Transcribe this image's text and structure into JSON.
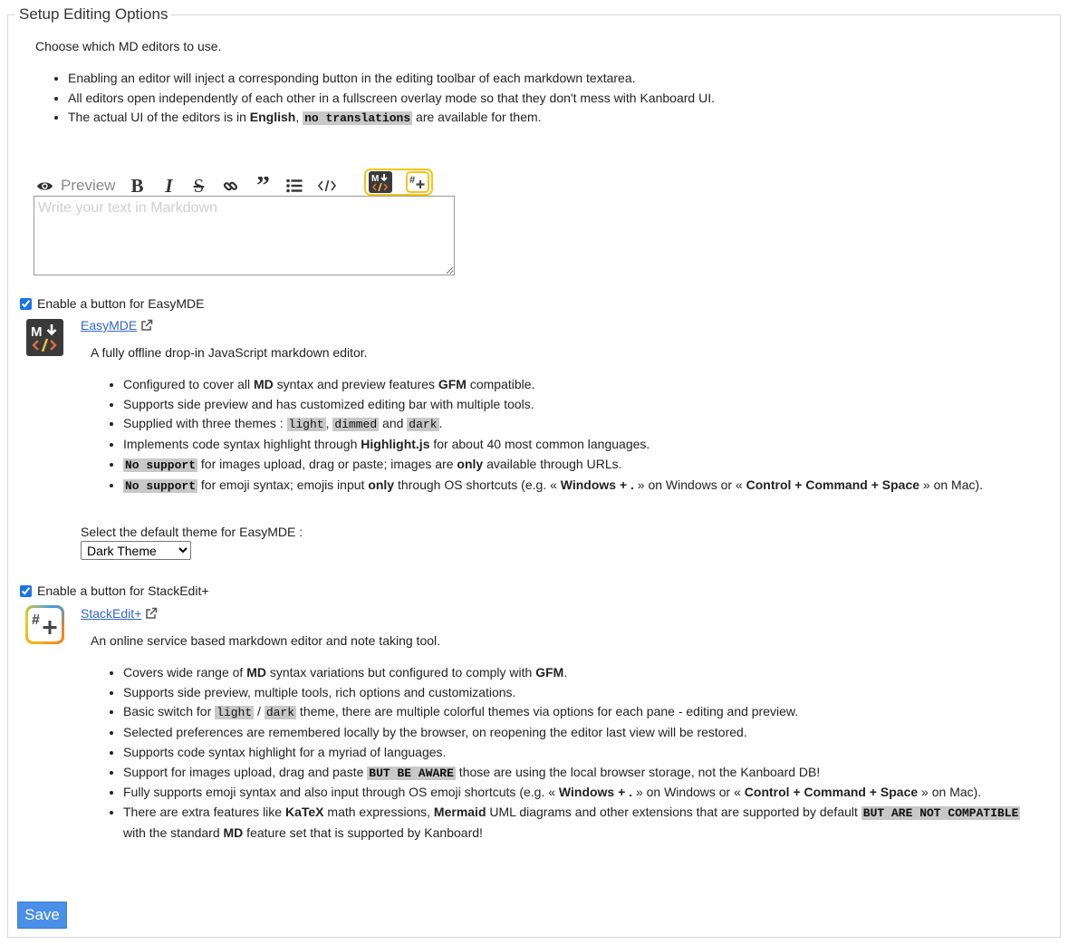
{
  "legend": "Setup Editing Options",
  "intro": "Choose which MD editors to use.",
  "intro_bullets": {
    "b1": "Enabling an editor will inject a corresponding button in the editing toolbar of each markdown textarea.",
    "b2": "All editors open independently of each other in a fullscreen overlay mode so that they don't mess with Kanboard UI.",
    "b3_pre": "The actual UI of the editors is in ",
    "b3_bold": "English",
    "b3_sep": ", ",
    "b3_code": "no translations",
    "b3_post": " are available for them."
  },
  "toolbar": {
    "preview_label": "Preview",
    "textarea_placeholder": "Write your text in Markdown",
    "icons": [
      "eye-icon",
      "bold-icon",
      "italic-icon",
      "strikethrough-icon",
      "link-icon",
      "quote-icon",
      "list-icon",
      "code-icon",
      "easymde-icon",
      "stackedit-icon",
      "arrow-up-icon"
    ],
    "highlight_color": "#f5c518"
  },
  "easymde": {
    "checkbox_label": "Enable a button for EasyMDE",
    "checked": true,
    "link_text": "EasyMDE",
    "description": "A fully offline drop-in JavaScript markdown editor.",
    "f1_pre": "Configured to cover all ",
    "f1_b1": "MD",
    "f1_mid": " syntax and preview features ",
    "f1_b2": "GFM",
    "f1_post": " compatible.",
    "f2": "Supports side preview and has customized editing bar with multiple tools.",
    "f3_pre": "Supplied with three themes : ",
    "f3_c1": "light",
    "f3_sep1": ", ",
    "f3_c2": "dimmed",
    "f3_sep2": " and ",
    "f3_c3": "dark",
    "f3_post": ".",
    "f4_pre": "Implements code syntax highlight through ",
    "f4_b": "Highlight.js",
    "f4_post": " for about 40 most common languages.",
    "f5_code": "No support",
    "f5_mid": " for images upload, drag or paste; images are ",
    "f5_b": "only",
    "f5_post": " available through URLs.",
    "f6_code": "No support",
    "f6_mid": " for emoji syntax; emojis input ",
    "f6_b1": "only",
    "f6_mid2": " through OS shortcuts (e.g. « ",
    "f6_b2": "Windows + .",
    "f6_mid3": " » on Windows or « ",
    "f6_b3": "Control + Command + Space",
    "f6_post": " » on Mac).",
    "theme_label": "Select the default theme for EasyMDE :",
    "theme_selected": "Dark Theme"
  },
  "stackedit": {
    "checkbox_label": "Enable a button for StackEdit+",
    "checked": true,
    "link_text": "StackEdit+",
    "description": "An online service based markdown editor and note taking tool.",
    "f1_pre": "Covers wide range of ",
    "f1_b1": "MD",
    "f1_mid": " syntax variations but configured to comply with ",
    "f1_b2": "GFM",
    "f1_post": ".",
    "f2": "Supports side preview, multiple tools, rich options and customizations.",
    "f3_pre": "Basic switch for ",
    "f3_c1": "light",
    "f3_sep": " / ",
    "f3_c2": "dark",
    "f3_post": " theme, there are multiple colorful themes via options for each pane - editing and preview.",
    "f4": "Selected preferences are remembered locally by the browser, on reopening the editor last view will be restored.",
    "f5": "Supports code syntax highlight for a myriad of languages.",
    "f6_pre": "Support for images upload, drag and paste ",
    "f6_code": "BUT BE AWARE",
    "f6_post": " those are using the local browser storage, not the Kanboard DB!",
    "f7_pre": "Fully supports emoji syntax and also input through OS emoji shortcuts (e.g. « ",
    "f7_b1": "Windows + .",
    "f7_mid": " » on Windows or « ",
    "f7_b2": "Control + Command + Space",
    "f7_post": " » on Mac).",
    "f8_pre": "There are extra features like ",
    "f8_b1": "KaTeX",
    "f8_mid1": " math expressions, ",
    "f8_b2": "Mermaid",
    "f8_mid2": " UML diagrams and other extensions that are supported by default ",
    "f8_code": "BUT ARE NOT COMPATIBLE",
    "f8_mid3": " with the standard ",
    "f8_b3": "MD",
    "f8_post": " feature set that is supported by Kanboard!"
  },
  "save_label": "Save"
}
